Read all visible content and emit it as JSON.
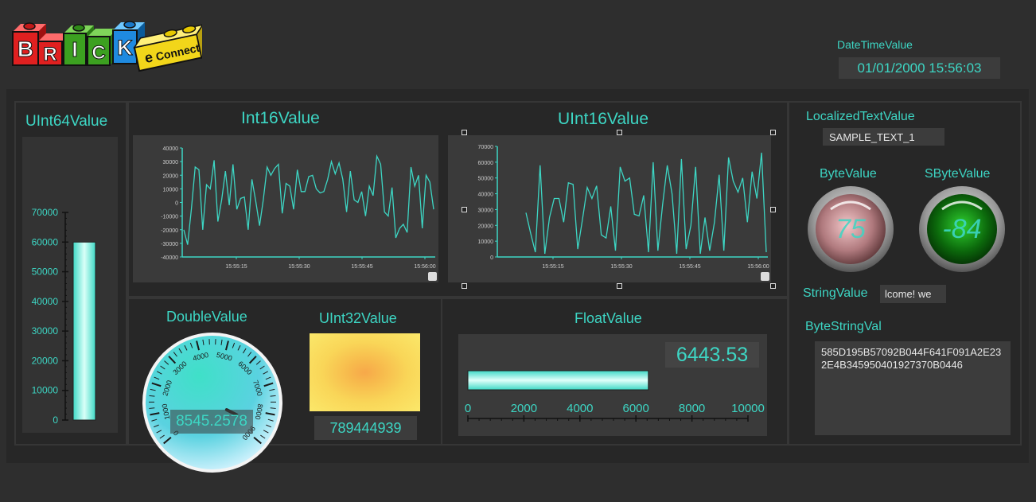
{
  "header": {
    "logo_text": "BRICK e Connect",
    "datetime_label": "DateTimeValue",
    "datetime_value": "01/01/2000 15:56:03"
  },
  "uint64": {
    "label": "UInt64Value",
    "ticks": [
      "70000",
      "60000",
      "50000",
      "40000",
      "30000",
      "20000",
      "10000",
      "0"
    ],
    "value": 60000,
    "max": 70000
  },
  "int16": {
    "label": "Int16Value",
    "chart_data": {
      "type": "line",
      "y_ticks": [
        "40000",
        "30000",
        "20000",
        "10000",
        "0",
        "-10000",
        "-20000",
        "-30000",
        "-40000"
      ],
      "x_ticks": [
        "15:55:15",
        "15:55:30",
        "15:55:45",
        "15:56:00"
      ],
      "ylim": [
        -40000,
        40000
      ],
      "values": [
        -20000,
        -31000,
        -5000,
        26000,
        24000,
        -20000,
        13000,
        10000,
        31000,
        -14000,
        2000,
        23000,
        -2000,
        28000,
        -5000,
        3000,
        4000,
        -20000,
        17000,
        1000,
        -17000,
        2000,
        26000,
        20000,
        25000,
        28000,
        -8000,
        14000,
        12000,
        -5000,
        24000,
        8000,
        8000,
        19000,
        20000,
        10000,
        7000,
        8000,
        17000,
        30000,
        21000,
        29000,
        17000,
        -7000,
        23000,
        2000,
        0,
        8000,
        -10000,
        12000,
        5000,
        34000,
        28000,
        -7000,
        -10000,
        11000,
        -26000,
        -19000,
        -16000,
        -22000,
        26000,
        12000,
        20000,
        -19000,
        20000,
        15000,
        -5000
      ]
    }
  },
  "uint16": {
    "label": "UInt16Value",
    "chart_data": {
      "type": "line",
      "y_ticks": [
        "70000",
        "60000",
        "50000",
        "40000",
        "30000",
        "20000",
        "10000",
        "0"
      ],
      "x_ticks": [
        "15:55:15",
        "15:55:30",
        "15:55:45",
        "15:56:00"
      ],
      "ylim": [
        0,
        70000
      ],
      "values": [
        28000,
        15000,
        3000,
        58000,
        2000,
        25000,
        37000,
        37000,
        22000,
        47000,
        46000,
        5000,
        24000,
        44000,
        37000,
        45000,
        14000,
        12000,
        32000,
        4000,
        57000,
        48000,
        50000,
        27000,
        26000,
        39000,
        3000,
        60000,
        4000,
        33000,
        58000,
        40000,
        2000,
        62000,
        5000,
        20000,
        57000,
        2000,
        25000,
        4000,
        22000,
        52000,
        4000,
        63000,
        48000,
        41000,
        50000,
        22000,
        54000,
        37000,
        66000,
        3000
      ]
    }
  },
  "double": {
    "label": "DoubleValue",
    "value": "8545.2578",
    "ticks": [
      "0",
      "1000",
      "2000",
      "3000",
      "4000",
      "5000",
      "6000",
      "7000",
      "8000",
      "9000"
    ],
    "max": 9000,
    "reading": 8545.2578
  },
  "uint32": {
    "label": "UInt32Value",
    "value": "789444939"
  },
  "float": {
    "label": "FloatValue",
    "value": "6443.53",
    "ticks": [
      "0",
      "2000",
      "4000",
      "6000",
      "8000",
      "10000"
    ],
    "max": 10000,
    "reading": 6443.53
  },
  "localized": {
    "label": "LocalizedTextValue",
    "value": "SAMPLE_TEXT_1"
  },
  "byte": {
    "label": "ByteValue",
    "value": "75"
  },
  "sbyte": {
    "label": "SByteValue",
    "value": "-84"
  },
  "string": {
    "label": "StringValue",
    "value": "lcome! we"
  },
  "bytestring": {
    "label": "ByteStringVal",
    "value": "585D195B57092B044F641F091A2E232E4B345950401927370B0446"
  },
  "colors": {
    "accent": "#3dd6c4",
    "background": "#2e2e2e",
    "panel": "#272727",
    "field": "#3c3c3c"
  }
}
